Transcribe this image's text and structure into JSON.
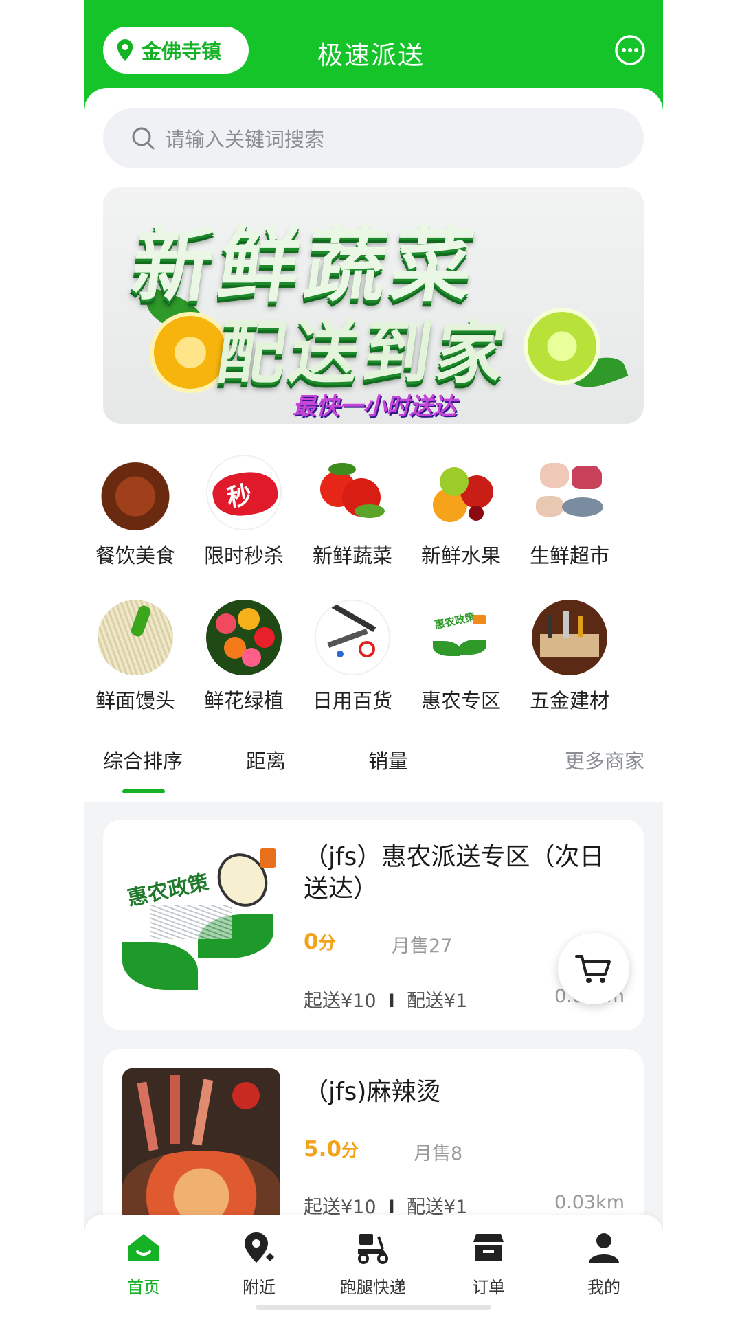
{
  "header": {
    "location": "金佛寺镇",
    "title": "极速派送"
  },
  "search": {
    "placeholder": "请输入关键词搜索"
  },
  "banner": {
    "line1": "新鲜蔬菜",
    "line2": "配送到家",
    "line3": "最快一小时送达"
  },
  "categories": [
    {
      "label": "餐饮美食",
      "icon": "food-icon"
    },
    {
      "label": "限时秒杀",
      "icon": "flash-sale-icon"
    },
    {
      "label": "新鲜蔬菜",
      "icon": "vegetable-icon"
    },
    {
      "label": "新鲜水果",
      "icon": "fruit-icon"
    },
    {
      "label": "生鲜超市",
      "icon": "fresh-market-icon"
    },
    {
      "label": "鲜面馒头",
      "icon": "noodle-icon"
    },
    {
      "label": "鲜花绿植",
      "icon": "flower-icon"
    },
    {
      "label": "日用百货",
      "icon": "daily-goods-icon"
    },
    {
      "label": "惠农专区",
      "icon": "agri-icon"
    },
    {
      "label": "五金建材",
      "icon": "hardware-icon"
    }
  ],
  "sort_tabs": [
    "综合排序",
    "距离",
    "销量",
    "更多商家"
  ],
  "shops": [
    {
      "name": "（jfs）惠农派送专区（次日送达）",
      "score": "0",
      "score_unit": "分",
      "sales": "月售27",
      "min_order": "起送¥10",
      "delivery_fee": "配送¥1",
      "distance": "0.03km"
    },
    {
      "name": "（jfs)麻辣烫",
      "score": "5.0",
      "score_unit": "分",
      "sales": "月售8",
      "min_order": "起送¥10",
      "delivery_fee": "配送¥1",
      "distance": "0.03km"
    }
  ],
  "thumb_text": "惠农政策",
  "fee_separator": "I",
  "bottom_nav": [
    {
      "label": "首页",
      "icon": "home-icon"
    },
    {
      "label": "附近",
      "icon": "nearby-icon"
    },
    {
      "label": "跑腿快递",
      "icon": "scooter-icon"
    },
    {
      "label": "订单",
      "icon": "order-icon"
    },
    {
      "label": "我的",
      "icon": "profile-icon"
    }
  ],
  "colors": {
    "brand": "#14c428",
    "accent_score": "#f2a21b"
  }
}
